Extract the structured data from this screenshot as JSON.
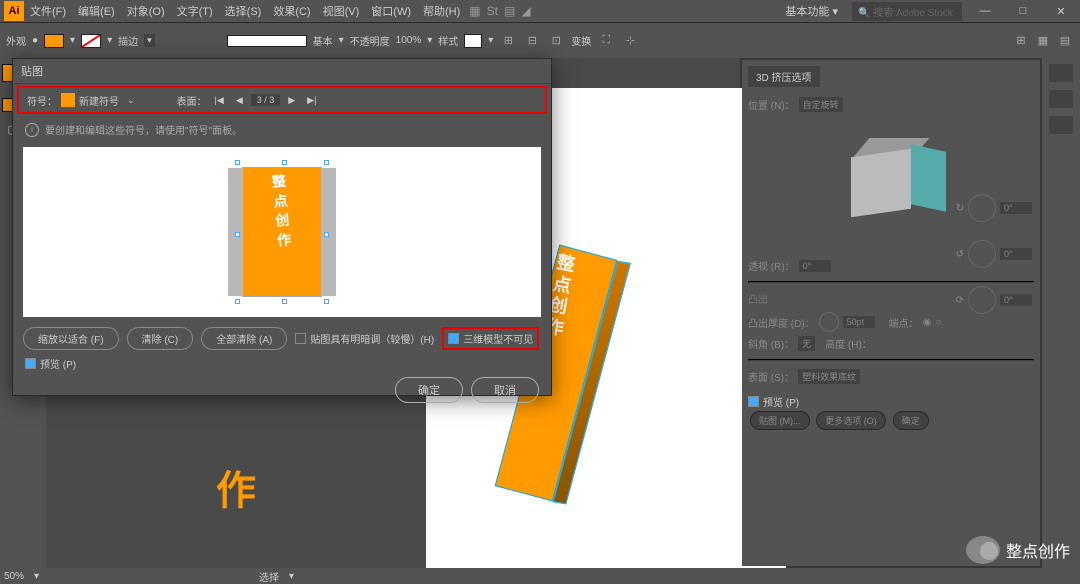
{
  "app": {
    "logo": "Ai"
  },
  "menu": [
    "文件(F)",
    "编辑(E)",
    "对象(O)",
    "文字(T)",
    "选择(S)",
    "效果(C)",
    "视图(V)",
    "窗口(W)",
    "帮助(H)"
  ],
  "top_right": {
    "workspace": "基本功能",
    "search_placeholder": "搜索 Adobe Stock"
  },
  "control": {
    "label1": "外观",
    "stroke_label": "描边",
    "style_label": "基本",
    "opacity_label": "不透明度",
    "opacity_val": "100%",
    "style2": "样式",
    "transform": "变换"
  },
  "dialog": {
    "title": "贴图",
    "symbol_label": "符号：",
    "symbol_name": "新建符号",
    "surface_label": "表面：",
    "page": "3 / 3",
    "info": "要创建和编辑这些符号，请使用\"符号\"面板。",
    "btn_fit": "缩放以适合 (F)",
    "btn_clear": "清除 (C)",
    "btn_clear_all": "全部清除 (A)",
    "check_shade": "贴图具有明暗调（较慢）(H)",
    "check_invisible": "三维模型不可见",
    "check_preview": "预览 (P)",
    "ok": "确定",
    "cancel": "取消"
  },
  "panel3d": {
    "tab": "3D 挤压选项",
    "pos_label": "位置 (N)：",
    "pos_val": "自定旋转",
    "perspective": "透视 (R)：",
    "perspective_val": "0°",
    "section": "凸出",
    "depth": "凸出厚度 (D)：",
    "depth_val": "50pt",
    "tilt": "端点：",
    "bevel": "斜角 (B)：",
    "bevel_val": "无",
    "bevel_h": "高度 (H)：",
    "surface": "表面 (S)：",
    "surface_val": "塑料效果底纹",
    "btn_preview": "预览 (P)",
    "btn_map": "贴图 (M)...",
    "btn_more": "更多选项 (O)",
    "btn_ok": "确定"
  },
  "zoom": {
    "val": "50%",
    "label": "选择"
  },
  "bg_text": "作",
  "watermark": "整点创作"
}
